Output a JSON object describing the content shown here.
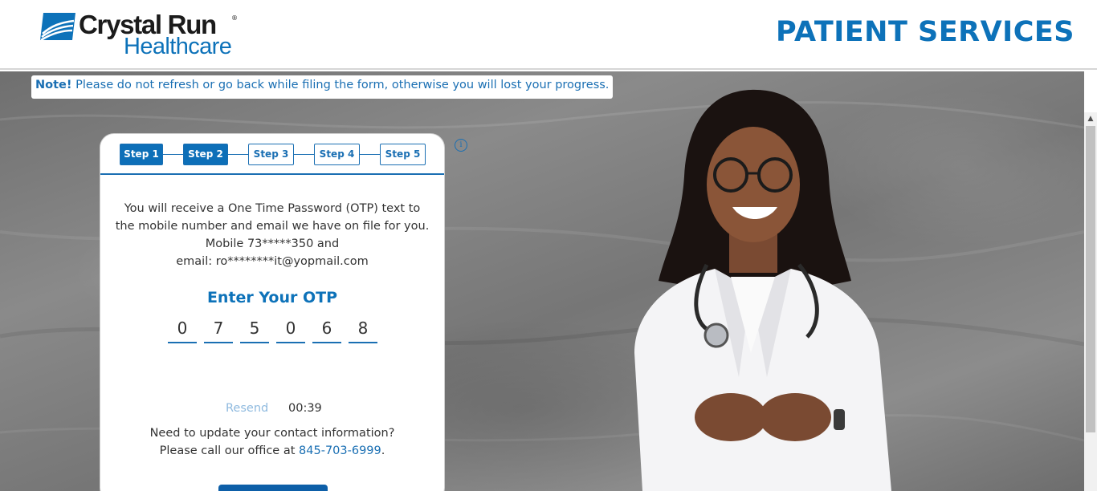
{
  "header": {
    "logo_line1": "Crystal Run",
    "logo_line2": "Healthcare",
    "title": "PATIENT SERVICES"
  },
  "note": {
    "label": "Note!",
    "text": " Please do not refresh or go back while filing the form, otherwise you will lost your progress."
  },
  "steps": [
    {
      "label": "Step 1",
      "active": true
    },
    {
      "label": "Step 2",
      "active": true
    },
    {
      "label": "Step 3",
      "active": false
    },
    {
      "label": "Step 4",
      "active": false
    },
    {
      "label": "Step 5",
      "active": false
    }
  ],
  "otp_card": {
    "message_line1": "You will receive a One Time Password (OTP) text to",
    "message_line2": "the mobile number and email we have on file for you.",
    "message_line3": "Mobile 73*****350 and",
    "message_line4": "email: ro********it@yopmail.com",
    "title": "Enter Your OTP",
    "digits": [
      "0",
      "7",
      "5",
      "0",
      "6",
      "8"
    ],
    "resend_label": "Resend",
    "timer": "00:39",
    "update_line1": "Need to update your contact information?",
    "update_line2_prefix": "Please call our office at ",
    "phone": "845-703-6999",
    "update_line2_suffix": "."
  },
  "colors": {
    "brand_blue": "#0d72b9",
    "button_blue": "#0d5fa8",
    "resend_disabled": "#8fbadf"
  },
  "icons": {
    "info": "info-icon",
    "logo": "logo-mark-icon",
    "scroll_up": "scroll-up-icon"
  }
}
